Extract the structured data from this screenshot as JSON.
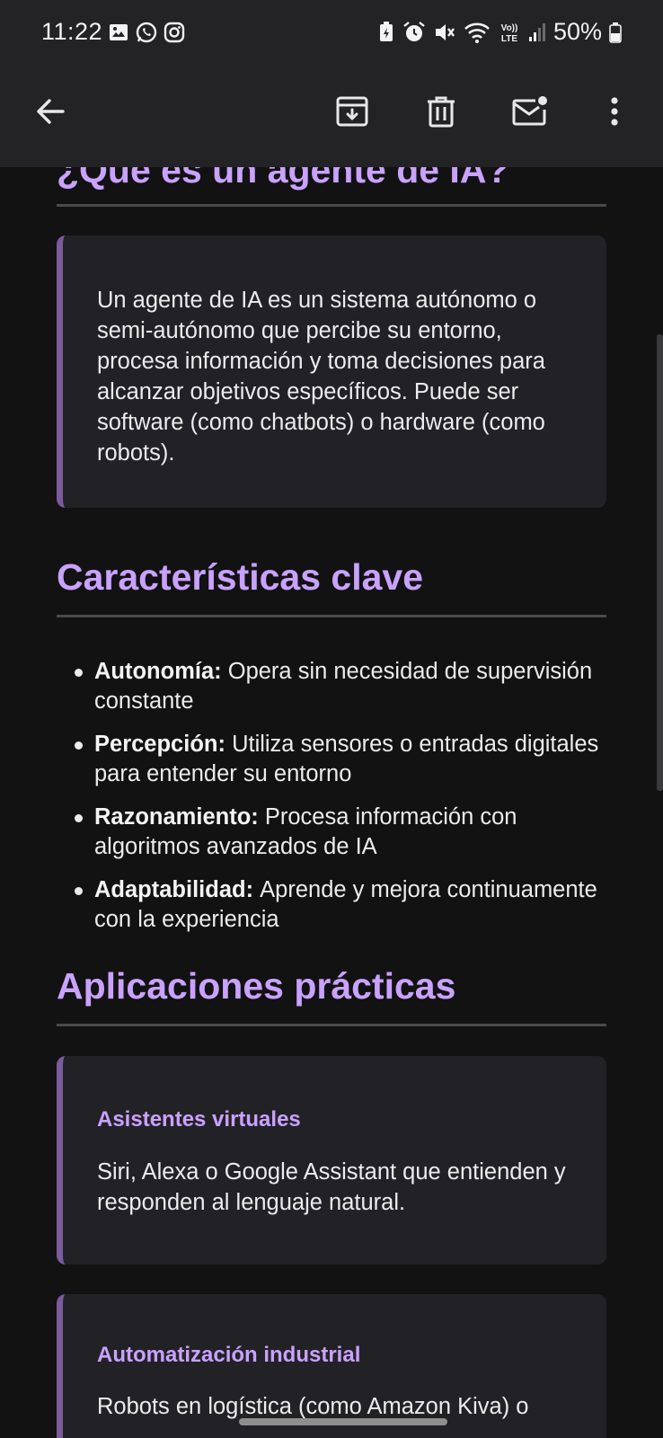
{
  "status_bar": {
    "time": "11:22",
    "battery": "50%",
    "left_icons": [
      "gallery-icon",
      "whatsapp-icon",
      "instagram-icon"
    ],
    "right_icons": [
      "battery-saver-icon",
      "alarm-icon",
      "mute-icon",
      "wifi-icon",
      "volte-icon",
      "signal-icon",
      "battery-icon"
    ],
    "volte_label": "Vo)) LTE"
  },
  "action_bar": {
    "buttons": [
      "back-arrow-icon",
      "archive-icon",
      "delete-icon",
      "mark-unread-icon",
      "more-vert-icon"
    ]
  },
  "email": {
    "section1_heading": "¿Qué es un agente de IA?",
    "section1_card_text": "Un agente de IA es un sistema autónomo o semi-autónomo que percibe su entorno, procesa información y toma decisiones para alcanzar objetivos específicos. Puede ser software (como chatbots) o hardware (como robots).",
    "section2_heading": "Características clave",
    "features": [
      {
        "term": "Autonomía:",
        "desc": "Opera sin necesidad de supervisión constante"
      },
      {
        "term": "Percepción:",
        "desc": "Utiliza sensores o entradas digitales para entender su entorno"
      },
      {
        "term": "Razonamiento:",
        "desc": "Procesa información con algoritmos avanzados de IA"
      },
      {
        "term": "Adaptabilidad:",
        "desc": "Aprende y mejora continuamente con la experiencia"
      }
    ],
    "section3_heading": "Aplicaciones prácticas",
    "applications": [
      {
        "title": "Asistentes virtuales",
        "text": "Siri, Alexa o Google Assistant que entienden y responden al lenguaje natural."
      },
      {
        "title": "Automatización industrial",
        "text": "Robots en logística (como Amazon Kiva) o"
      }
    ]
  },
  "colors": {
    "accent": "#c9a2ff",
    "card_bg": "#222226",
    "card_border": "#7b5a9e",
    "background": "#121212",
    "topbar": "#232326"
  }
}
